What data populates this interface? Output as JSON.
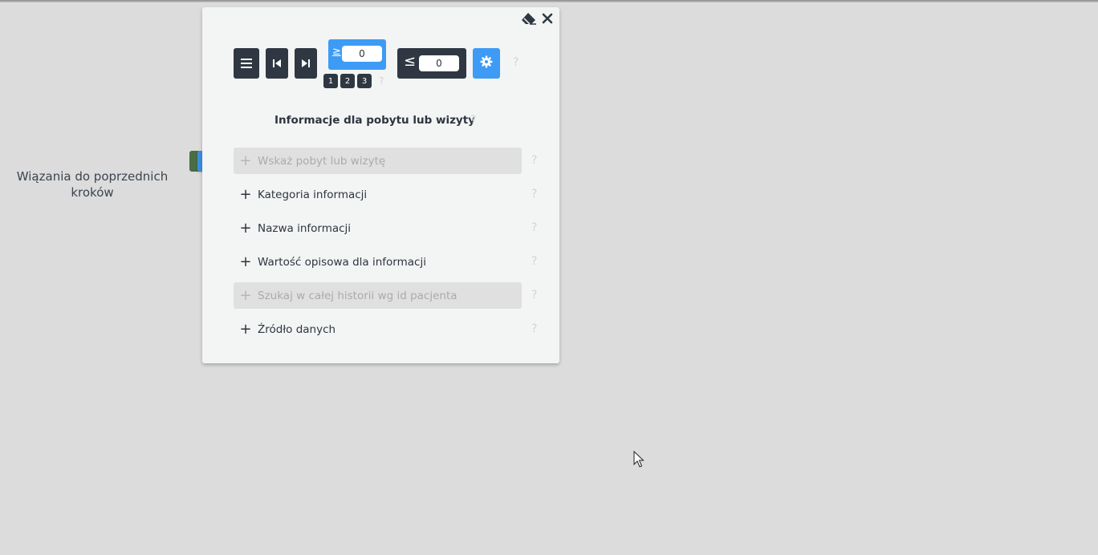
{
  "side_label": "Wiązania do poprzednich kroków",
  "toolbar": {
    "ge_symbol": "≥",
    "ge_value": "0",
    "le_symbol": "≤",
    "le_value": "0",
    "pages": [
      "1",
      "2",
      "3"
    ],
    "help": "?"
  },
  "panel": {
    "title": "Informacje dla pobytu lub wizyty",
    "help": "?",
    "fields": [
      {
        "label": "Wskaż pobyt lub wizytę",
        "disabled": true
      },
      {
        "label": "Kategoria informacji",
        "disabled": false
      },
      {
        "label": "Nazwa informacji",
        "disabled": false
      },
      {
        "label": "Wartość opisowa dla informacji",
        "disabled": false
      },
      {
        "label": "Szukaj w całej historii wg id pacjenta",
        "disabled": true
      },
      {
        "label": "Źródło danych",
        "disabled": false
      }
    ],
    "plus": "+"
  },
  "colors": {
    "accent_blue": "#3d9bf5",
    "dark_button": "#2f3842",
    "link_green": "#486e44",
    "background": "#dcdcdc"
  },
  "icons": [
    "eraser-icon",
    "close-icon",
    "menu-icon",
    "skip-first-icon",
    "skip-last-icon",
    "gear-icon",
    "link-icon",
    "cursor-icon"
  ]
}
